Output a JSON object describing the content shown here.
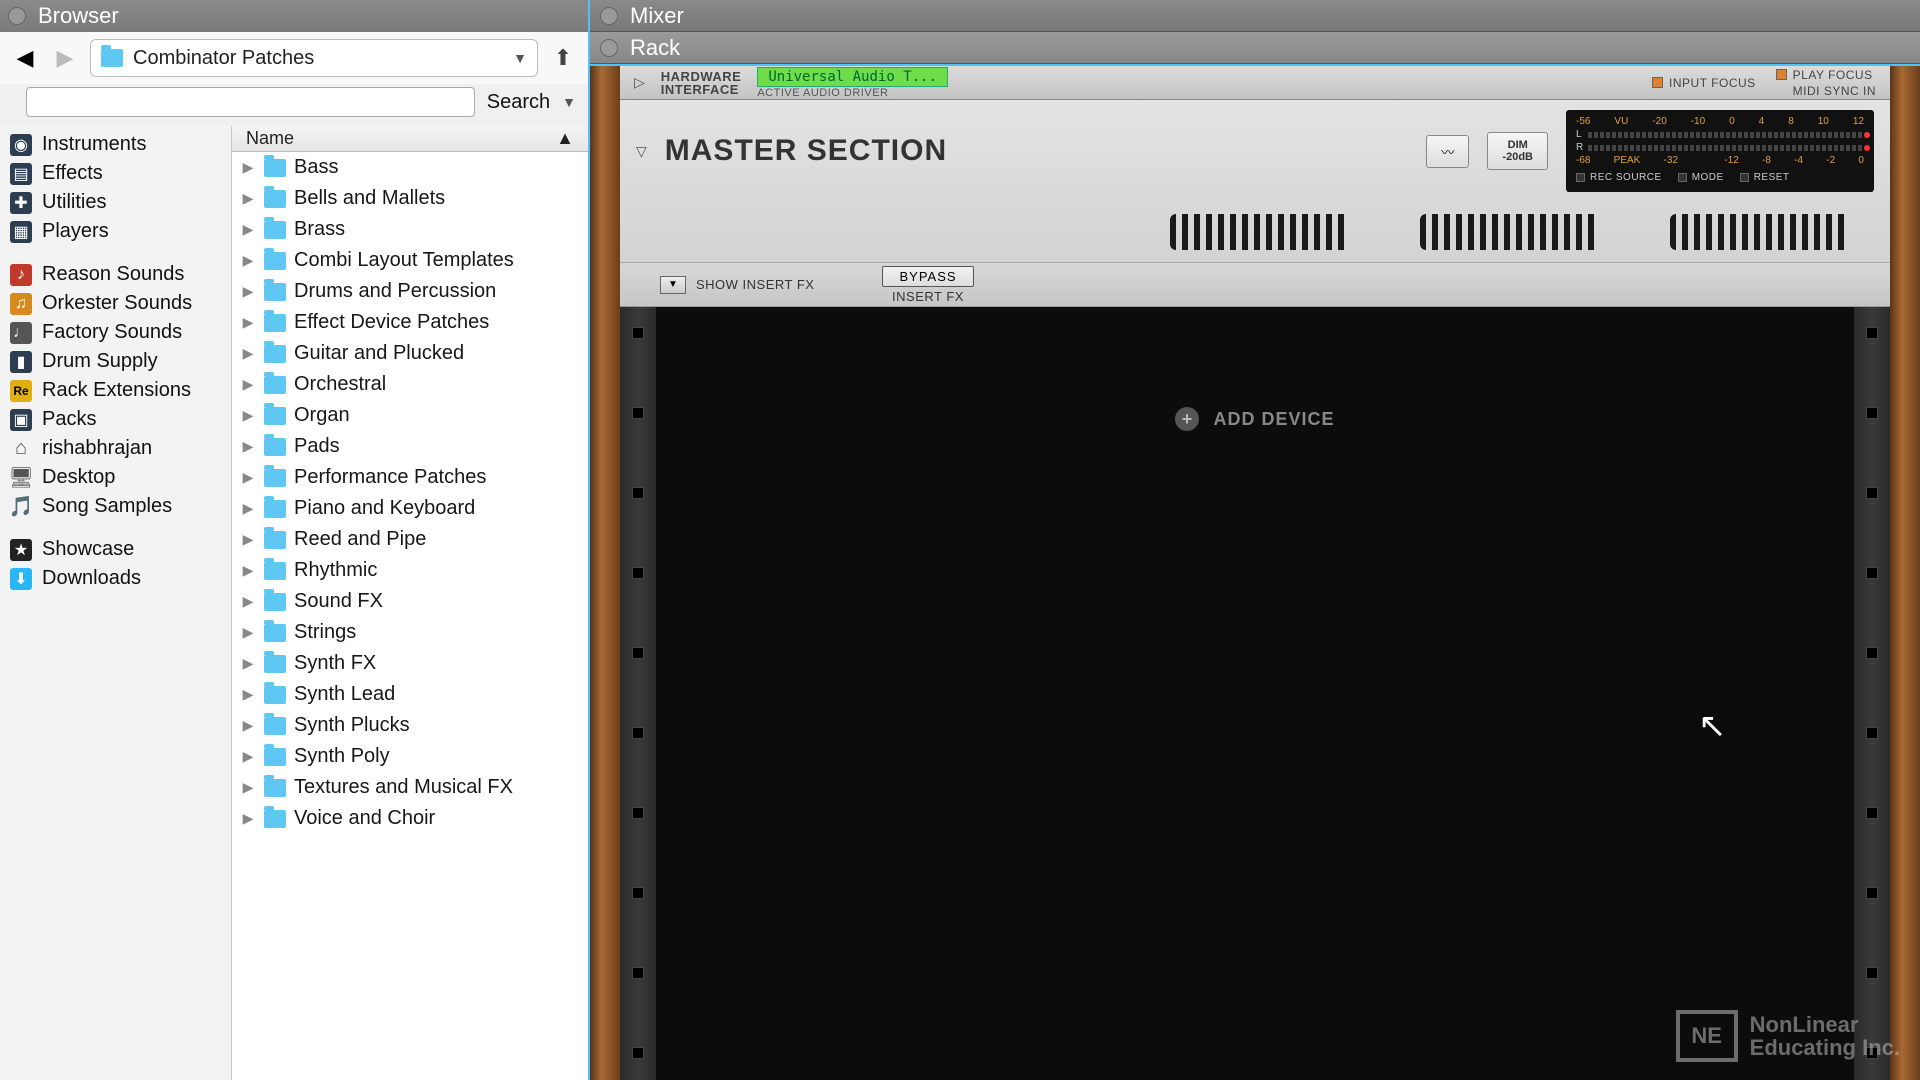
{
  "browser": {
    "title": "Browser",
    "path": "Combinator Patches",
    "search_label": "Search",
    "search_value": "",
    "name_header": "Name"
  },
  "sidebar": {
    "groups": [
      [
        {
          "icon": "square-dark",
          "glyph": "◉",
          "label": "Instruments"
        },
        {
          "icon": "square-dark",
          "glyph": "▤",
          "label": "Effects"
        },
        {
          "icon": "square-dark",
          "glyph": "✚",
          "label": "Utilities"
        },
        {
          "icon": "square-dark",
          "glyph": "▦",
          "label": "Players"
        }
      ],
      [
        {
          "icon": "square-red",
          "glyph": "♪",
          "label": "Reason Sounds"
        },
        {
          "icon": "square-orange",
          "glyph": "♫",
          "label": "Orkester Sounds"
        },
        {
          "icon": "square-grey",
          "glyph": "♩",
          "label": "Factory Sounds"
        },
        {
          "icon": "square-dark",
          "glyph": "▮",
          "label": "Drum Supply"
        },
        {
          "icon": "square-yellow",
          "glyph": "Re",
          "label": "Rack Extensions"
        },
        {
          "icon": "square-dark",
          "glyph": "▣",
          "label": "Packs"
        },
        {
          "icon": "plain",
          "glyph": "⌂",
          "label": "rishabhrajan"
        },
        {
          "icon": "plain",
          "glyph": "🖥",
          "label": "Desktop"
        },
        {
          "icon": "plain",
          "glyph": "🎵",
          "label": "Song Samples"
        }
      ],
      [
        {
          "icon": "star",
          "glyph": "★",
          "label": "Showcase"
        },
        {
          "icon": "cyan",
          "glyph": "⬇",
          "label": "Downloads"
        }
      ]
    ]
  },
  "folders": [
    "Bass",
    "Bells and Mallets",
    "Brass",
    "Combi Layout Templates",
    "Drums and Percussion",
    "Effect Device Patches",
    "Guitar and Plucked",
    "Orchestral",
    "Organ",
    "Pads",
    "Performance Patches",
    "Piano and Keyboard",
    "Reed and Pipe",
    "Rhythmic",
    "Sound FX",
    "Strings",
    "Synth FX",
    "Synth Lead",
    "Synth Plucks",
    "Synth Poly",
    "Textures and Musical FX",
    "Voice and Choir"
  ],
  "tabs": {
    "mixer": "Mixer",
    "rack": "Rack"
  },
  "hw": {
    "label1": "HARDWARE",
    "label2": "INTERFACE",
    "driver": "Universal Audio T...",
    "sub": "ACTIVE AUDIO DRIVER",
    "input_focus": "INPUT FOCUS",
    "play_focus": "PLAY FOCUS",
    "midi_sync": "MIDI SYNC IN"
  },
  "ms": {
    "title": "MASTER SECTION",
    "dim1": "DIM",
    "dim2": "-20dB",
    "rec_source": "REC SOURCE",
    "mode": "MODE",
    "reset": "RESET",
    "scale_top": [
      "-56",
      "VU",
      "-20",
      "-10",
      "0",
      "4",
      "8",
      "10",
      "12"
    ],
    "scale_bot": [
      "-68",
      "PEAK",
      "-32",
      "",
      "-12",
      "-8",
      "-4",
      "-2",
      "0"
    ]
  },
  "fx": {
    "show": "SHOW INSERT FX",
    "bypass": "BYPASS",
    "insert": "INSERT FX"
  },
  "rack": {
    "add_device": "ADD DEVICE"
  },
  "watermark": {
    "box": "NE",
    "line1": "NonLinear",
    "line2": "Educating Inc."
  }
}
